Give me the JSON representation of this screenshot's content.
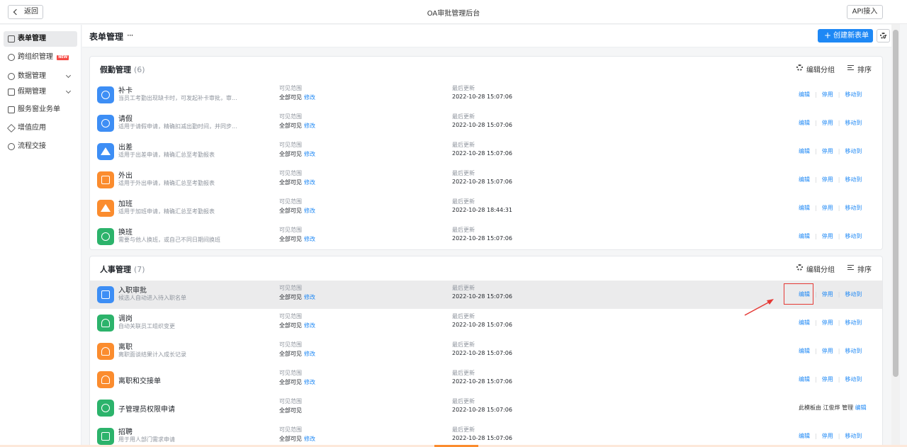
{
  "topbar": {
    "back_label": "返回",
    "app_title": "OA审批管理后台",
    "api_label": "API接入"
  },
  "sidebar": {
    "items": [
      {
        "label": "表单管理",
        "active": true
      },
      {
        "label": "跨组织管理",
        "badge": "NEW"
      },
      {
        "label": "数据管理",
        "expandable": true
      },
      {
        "label": "假期管理",
        "expandable": true
      },
      {
        "label": "服务窗业务单"
      },
      {
        "label": "增值应用"
      },
      {
        "label": "流程交接"
      }
    ]
  },
  "header": {
    "page_title": "表单管理",
    "more": "···",
    "create_label": "创建新表单"
  },
  "groups": [
    {
      "title": "假勤管理",
      "count": "(6)",
      "edit_group_label": "编辑分组",
      "sort_label": "排序",
      "rows": [
        {
          "name": "补卡",
          "desc": "当员工考勤出现缺卡时，可发起补卡审批，审...",
          "icon": "clock-icon",
          "color": "blue",
          "vis_label": "可见范围",
          "vis_value": "全部可见",
          "vis_modify": "修改",
          "upd_label": "最后更新",
          "upd_value": "2022-10-28 15:07:06",
          "op_edit": "编辑",
          "op_disable": "停用",
          "op_move": "移动到"
        },
        {
          "name": "请假",
          "desc": "适用于请假申请，精确扣减出勤时间，并同步...",
          "icon": "clock-icon",
          "color": "blue",
          "vis_label": "可见范围",
          "vis_value": "全部可见",
          "vis_modify": "修改",
          "upd_label": "最后更新",
          "upd_value": "2022-10-28 15:07:06",
          "op_edit": "编辑",
          "op_disable": "停用",
          "op_move": "移动到"
        },
        {
          "name": "出差",
          "desc": "适用于出差申请，精确汇总至考勤报表",
          "icon": "plane-icon",
          "color": "blue",
          "vis_label": "可见范围",
          "vis_value": "全部可见",
          "vis_modify": "修改",
          "upd_label": "最后更新",
          "upd_value": "2022-10-28 15:07:06",
          "op_edit": "编辑",
          "op_disable": "停用",
          "op_move": "移动到"
        },
        {
          "name": "外出",
          "desc": "适用于外出申请，精确汇总至考勤报表",
          "icon": "car-icon",
          "color": "orange",
          "vis_label": "可见范围",
          "vis_value": "全部可见",
          "vis_modify": "修改",
          "upd_label": "最后更新",
          "upd_value": "2022-10-28 15:07:06",
          "op_edit": "编辑",
          "op_disable": "停用",
          "op_move": "移动到"
        },
        {
          "name": "加班",
          "desc": "适用于加班申请，精确汇总至考勤报表",
          "icon": "overtime-icon",
          "color": "orange",
          "vis_label": "可见范围",
          "vis_value": "全部可见",
          "vis_modify": "修改",
          "upd_label": "最后更新",
          "upd_value": "2022-10-28 18:44:31",
          "op_edit": "编辑",
          "op_disable": "停用",
          "op_move": "移动到"
        },
        {
          "name": "换班",
          "desc": "需要与他人换班，或自己不同日期间换班",
          "icon": "swap-icon",
          "color": "green",
          "vis_label": "可见范围",
          "vis_value": "全部可见",
          "vis_modify": "修改",
          "upd_label": "最后更新",
          "upd_value": "2022-10-28 15:07:06",
          "op_edit": "编辑",
          "op_disable": "停用",
          "op_move": "移动到"
        }
      ]
    },
    {
      "title": "人事管理",
      "count": "(7)",
      "edit_group_label": "编辑分组",
      "sort_label": "排序",
      "rows": [
        {
          "name": "入职审批",
          "desc": "候选人自动进入待入职名单",
          "icon": "onboard-icon",
          "color": "blue",
          "vis_label": "可见范围",
          "vis_value": "全部可见",
          "vis_modify": "修改",
          "upd_label": "最后更新",
          "upd_value": "2022-10-28 15:07:06",
          "op_edit": "编辑",
          "op_disable": "停用",
          "op_move": "移动到",
          "highlight": true
        },
        {
          "name": "调岗",
          "desc": "自动关联员工组织变更",
          "icon": "transfer-icon",
          "color": "green",
          "vis_label": "可见范围",
          "vis_value": "全部可见",
          "vis_modify": "修改",
          "upd_label": "最后更新",
          "upd_value": "2022-10-28 15:07:06",
          "op_edit": "编辑",
          "op_disable": "停用",
          "op_move": "移动到"
        },
        {
          "name": "离职",
          "desc": "离职面谈结果计入成长记录",
          "icon": "resign-icon",
          "color": "orange",
          "vis_label": "可见范围",
          "vis_value": "全部可见",
          "vis_modify": "修改",
          "upd_label": "最后更新",
          "upd_value": "2022-10-28 15:07:06",
          "op_edit": "编辑",
          "op_disable": "停用",
          "op_move": "移动到"
        },
        {
          "name": "离职和交接单",
          "desc": "",
          "icon": "handover-icon",
          "color": "orange",
          "vis_label": "可见范围",
          "vis_value": "全部可见",
          "vis_modify": "修改",
          "upd_label": "最后更新",
          "upd_value": "2022-10-28 15:07:06",
          "op_edit": "编辑",
          "op_disable": "停用",
          "op_move": "移动到"
        },
        {
          "name": "子管理员权限申请",
          "desc": "",
          "icon": "admin-icon",
          "color": "green",
          "vis_label": "可见范围",
          "vis_value": "全部可见",
          "vis_modify": "",
          "upd_label": "最后更新",
          "upd_value": "2022-10-28 15:07:06",
          "ops_note_prefix": "此模板由 ",
          "ops_note_name": "江俊烨",
          "ops_note_suffix": " 管理 ",
          "op_edit": "编辑"
        },
        {
          "name": "招聘",
          "desc": "用于用人部门需求申请",
          "icon": "recruit-icon",
          "color": "green",
          "vis_label": "可见范围",
          "vis_value": "全部可见",
          "vis_modify": "修改",
          "upd_label": "最后更新",
          "upd_value": "2022-10-28 15:07:06",
          "op_edit": "编辑",
          "op_disable": "停用",
          "op_move": "移动到"
        }
      ]
    }
  ],
  "colors": {
    "accent": "#1e88f5",
    "blue_icon": "#3d8ef5",
    "orange_icon": "#fb8c2e",
    "green_icon": "#2cb36b",
    "annotation_red": "#e53935"
  }
}
